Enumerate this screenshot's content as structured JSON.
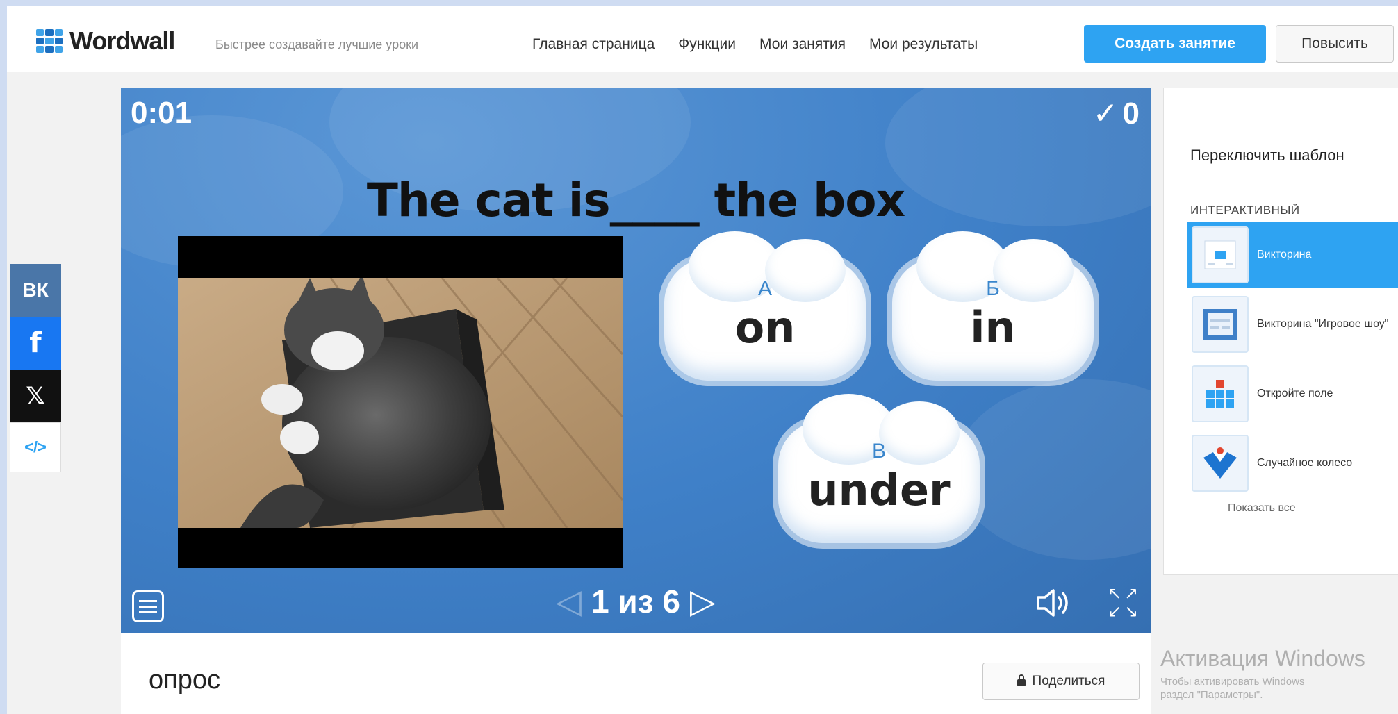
{
  "header": {
    "logo_text": "Wordwall",
    "tagline": "Быстрее создавайте лучшие уроки",
    "nav": [
      "Главная страница",
      "Функции",
      "Мои занятия",
      "Мои результаты"
    ],
    "create_button": "Создать занятие",
    "upgrade_button": "Повысить"
  },
  "social": {
    "vk": "ВК",
    "facebook": "f",
    "x": "𝕏",
    "embed": "</>"
  },
  "game": {
    "timer": "0:01",
    "score_icon": "check-icon",
    "score_symbol": "✓",
    "score": "0",
    "question": "The cat is____ the box",
    "image_description_icon": "cat-in-box-photo",
    "answers": [
      {
        "letter": "А",
        "text": "on"
      },
      {
        "letter": "Б",
        "text": "in"
      },
      {
        "letter": "В",
        "text": "under"
      }
    ],
    "page_current": "1",
    "page_text": "1 из 6",
    "page_total": "6",
    "prev_symbol": "◁",
    "next_symbol": "▷",
    "sound_symbol": "🔈",
    "fullscreen_symbols": [
      "↖",
      "↗",
      "↙",
      "↘"
    ]
  },
  "below": {
    "title": "опрос",
    "share_button": "Поделиться"
  },
  "panel": {
    "title": "Переключить шаблон",
    "section": "ИНТЕРАКТИВНЫЙ",
    "templates": [
      {
        "label": "Викторина",
        "active": true
      },
      {
        "label": "Викторина \"Игровое шоу\"",
        "active": false
      },
      {
        "label": "Откройте поле",
        "active": false
      },
      {
        "label": "Случайное колесо",
        "active": false
      }
    ],
    "show_all": "Показать все"
  },
  "watermark": {
    "line1": "Активация Windows",
    "line2": "Чтобы активировать Windows",
    "line3": "раздел \"Параметры\"."
  },
  "colors": {
    "accent": "#2ea3f2",
    "game_bg": "#3f80c8",
    "vk": "#4a76a8",
    "facebook": "#1877f2"
  }
}
